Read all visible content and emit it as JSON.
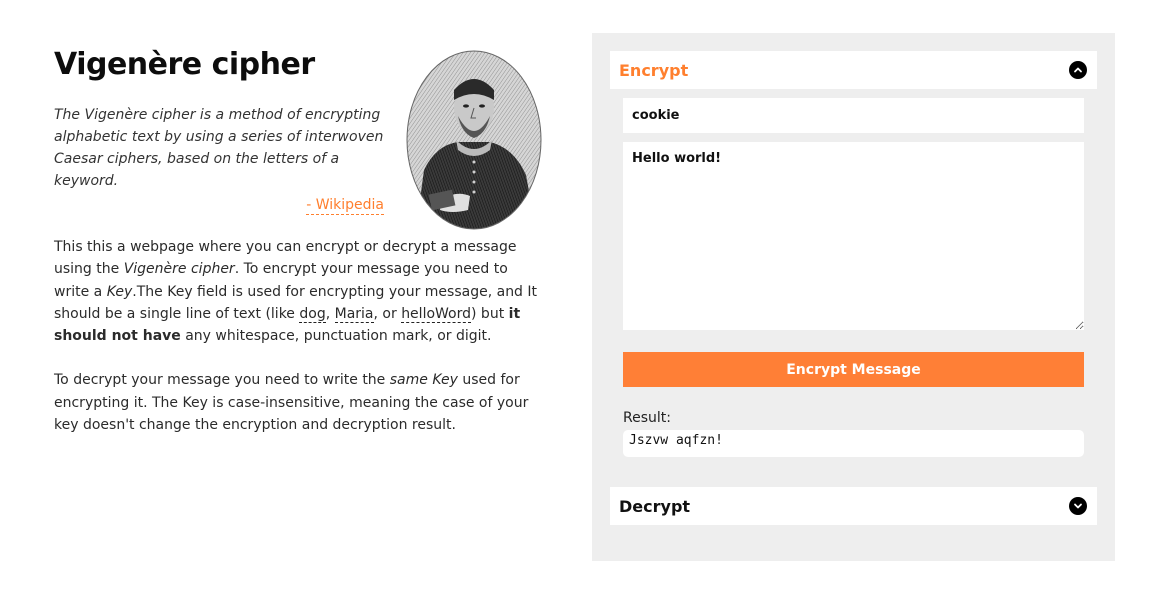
{
  "header": {
    "title": "Vigenère cipher"
  },
  "quote": {
    "text": "The Vigenère cipher is a method of encrypting alphabetic text by using a series of interwoven Caesar ciphers, based on the letters of a keyword.",
    "source": "- Wikipedia"
  },
  "intro": {
    "p1_a": "This this a webpage where you can encrypt or decrypt a message using the ",
    "p1_b": "Vigenère cipher",
    "p1_c": ". To encrypt your message you need to write a ",
    "p1_d": "Key",
    "p1_e": ".The Key field is used for encrypting your message, and It should be a single line of text (like ",
    "ex1": "dog",
    "sep1": ", ",
    "ex2": "Maria",
    "sep2": ", or ",
    "ex3": "helloWord",
    "p1_f": ") but ",
    "p1_strong": "it should not have",
    "p1_g": " any whitespace, punctuation mark, or digit.",
    "p2_a": "To decrypt your message you need to write the ",
    "p2_b": "same Key",
    "p2_c": " used for encrypting it. The Key is case-insensitive, meaning the case of your key doesn't change the encryption and decryption result."
  },
  "encrypt": {
    "title": "Encrypt",
    "key_value": "cookie",
    "message_value": "Hello world!",
    "button_label": "Encrypt Message",
    "result_label": "Result:",
    "result_value": "Jszvw aqfzn!"
  },
  "decrypt": {
    "title": "Decrypt"
  },
  "colors": {
    "accent": "#ff7f2e",
    "panel_bg": "#eeeeee"
  },
  "icons": {
    "encrypt_toggle": "chevron-up-icon",
    "decrypt_toggle": "chevron-down-icon"
  }
}
